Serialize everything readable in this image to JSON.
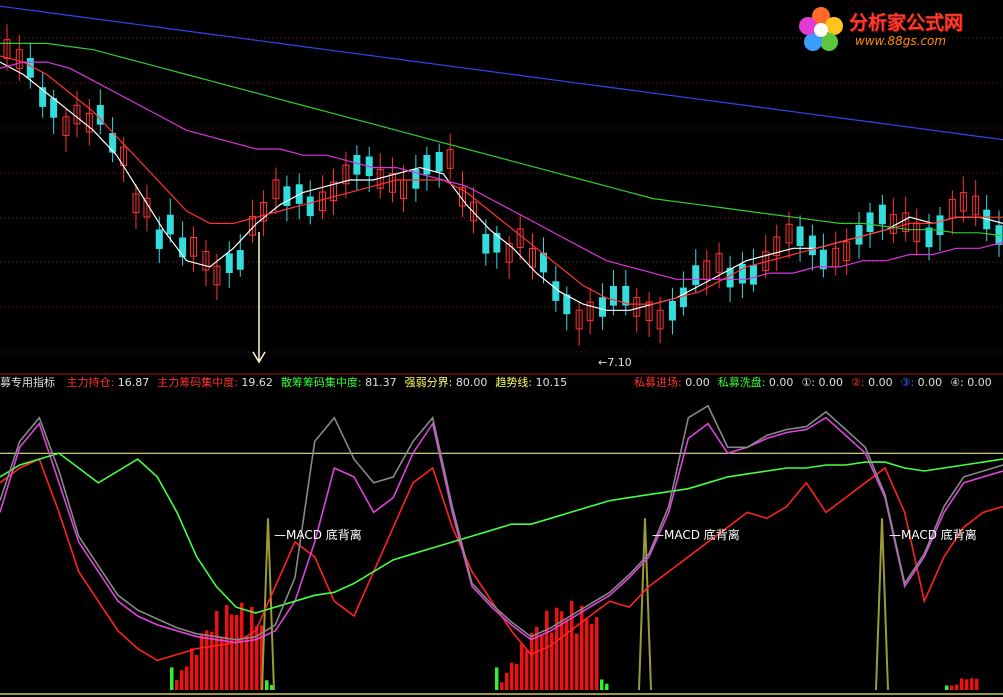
{
  "logo": {
    "title": "分析家公式网",
    "url": "www.88gs.com"
  },
  "indicator_legend": {
    "name": "募专用指标",
    "items": [
      {
        "label": "主力持仓:",
        "value": "16.87",
        "color": "#ff3333"
      },
      {
        "label": "主力筹码集中度:",
        "value": "19.62",
        "color": "#ff3333"
      },
      {
        "label": "散筹筹码集中度:",
        "value": "81.37",
        "color": "#33ff33"
      },
      {
        "label": "强弱分界:",
        "value": "80.00",
        "color": "#ffff66"
      },
      {
        "label": "趋势线:",
        "value": "10.15",
        "color": "#ffff66"
      }
    ],
    "right_items": [
      {
        "label": "私募进场:",
        "value": "0.00",
        "color": "#ff3333"
      },
      {
        "label": "私募洗盘:",
        "value": "0.00",
        "color": "#33ff33"
      },
      {
        "label": "①:",
        "value": "0.00",
        "color": "#e0e0e0"
      },
      {
        "label": "②:",
        "value": "0.00",
        "color": "#ff3333"
      },
      {
        "label": "③:",
        "value": "0.00",
        "color": "#3366ff"
      },
      {
        "label": "④:",
        "value": "0.00",
        "color": "#e0e0e0"
      }
    ]
  },
  "chart_data": [
    {
      "type": "line",
      "panel": "price",
      "low_marker": "7.10",
      "series": [
        {
          "color": "#ffffff",
          "values": [
            11.6,
            11.4,
            11.1,
            10.8,
            10.5,
            10.1,
            9.5,
            8.9,
            8.4,
            8.3,
            8.6,
            9.0,
            9.3,
            9.5,
            9.6,
            9.7,
            9.7,
            9.8,
            9.9,
            9.8,
            9.3,
            8.9,
            8.6,
            8.2,
            7.9,
            7.7,
            7.6,
            7.6,
            7.7,
            7.8,
            8.0,
            8.2,
            8.4,
            8.5,
            8.6,
            8.6,
            8.7,
            8.8,
            8.9,
            9.1,
            9.0,
            9.1,
            9.1,
            9.0
          ]
        },
        {
          "color": "#ff3333",
          "values": [
            11.7,
            11.6,
            11.4,
            11.1,
            10.8,
            10.4,
            10.0,
            9.6,
            9.2,
            9.0,
            9.0,
            9.1,
            9.2,
            9.3,
            9.4,
            9.5,
            9.6,
            9.7,
            9.7,
            9.7,
            9.5,
            9.2,
            8.9,
            8.6,
            8.3,
            8.0,
            7.8,
            7.7,
            7.7,
            7.8,
            7.9,
            8.1,
            8.3,
            8.4,
            8.5,
            8.6,
            8.7,
            8.8,
            8.9,
            9.0,
            9.0,
            9.1,
            9.1,
            9.1
          ]
        },
        {
          "color": "#dd33dd",
          "values": [
            11.5,
            11.6,
            11.6,
            11.5,
            11.3,
            11.1,
            10.9,
            10.7,
            10.5,
            10.4,
            10.3,
            10.2,
            10.2,
            10.1,
            10.1,
            10.0,
            9.9,
            9.9,
            9.8,
            9.7,
            9.6,
            9.4,
            9.2,
            9.0,
            8.8,
            8.6,
            8.4,
            8.3,
            8.2,
            8.1,
            8.1,
            8.1,
            8.1,
            8.2,
            8.2,
            8.3,
            8.3,
            8.4,
            8.4,
            8.5,
            8.5,
            8.6,
            8.6,
            8.7
          ]
        },
        {
          "color": "#33cc33",
          "values": [
            11.9,
            11.9,
            11.9,
            11.85,
            11.8,
            11.7,
            11.6,
            11.5,
            11.4,
            11.3,
            11.2,
            11.1,
            11.0,
            10.9,
            10.8,
            10.7,
            10.6,
            10.5,
            10.4,
            10.3,
            10.2,
            10.1,
            10.0,
            9.9,
            9.8,
            9.7,
            9.6,
            9.5,
            9.4,
            9.35,
            9.3,
            9.25,
            9.2,
            9.15,
            9.1,
            9.05,
            9.0,
            9.0,
            8.95,
            8.9,
            8.9,
            8.85,
            8.85,
            8.8
          ]
        },
        {
          "color": "#3344ee",
          "values": [
            12.5,
            12.45,
            12.4,
            12.35,
            12.3,
            12.25,
            12.2,
            12.15,
            12.1,
            12.05,
            12.0,
            11.95,
            11.9,
            11.85,
            11.8,
            11.75,
            11.7,
            11.65,
            11.6,
            11.55,
            11.5,
            11.45,
            11.4,
            11.35,
            11.3,
            11.25,
            11.2,
            11.15,
            11.1,
            11.05,
            11.0,
            10.95,
            10.9,
            10.85,
            10.8,
            10.75,
            10.7,
            10.65,
            10.6,
            10.55,
            10.5,
            10.45,
            10.4,
            10.35
          ]
        }
      ]
    },
    {
      "type": "line",
      "panel": "indicator",
      "annotations": [
        "MACD 底背离",
        "MACD 底背离",
        "MACD 底背离"
      ],
      "ylim": [
        0,
        100
      ],
      "reference_line": 80,
      "series": [
        {
          "color": "#ff2222",
          "values": [
            70,
            75,
            78,
            60,
            40,
            30,
            20,
            14,
            10,
            12,
            14,
            15,
            16,
            20,
            35,
            50,
            45,
            30,
            25,
            40,
            55,
            70,
            75,
            55,
            40,
            30,
            20,
            12,
            15,
            20,
            25,
            30,
            28,
            35,
            40,
            45,
            50,
            55,
            60,
            58,
            62,
            70,
            60,
            65,
            70,
            75,
            60,
            30,
            45,
            55,
            60,
            62
          ]
        },
        {
          "color": "#dd44dd",
          "values": [
            60,
            82,
            90,
            70,
            50,
            40,
            30,
            25,
            22,
            20,
            18,
            17,
            16,
            17,
            20,
            30,
            50,
            75,
            72,
            60,
            65,
            80,
            90,
            60,
            35,
            28,
            22,
            17,
            20,
            24,
            28,
            32,
            38,
            45,
            60,
            85,
            90,
            80,
            82,
            85,
            87,
            88,
            92,
            86,
            80,
            65,
            35,
            45,
            60,
            70,
            72,
            74
          ]
        },
        {
          "color": "#44ff44",
          "values": [
            72,
            76,
            78,
            80,
            75,
            70,
            74,
            78,
            72,
            60,
            45,
            35,
            28,
            26,
            28,
            30,
            32,
            33,
            36,
            40,
            44,
            46,
            48,
            50,
            52,
            54,
            56,
            56,
            58,
            60,
            62,
            64,
            65,
            66,
            67,
            68,
            70,
            72,
            73,
            74,
            75,
            75,
            76,
            76,
            77,
            77,
            75,
            74,
            75,
            76,
            77,
            78
          ]
        },
        {
          "color": "#888888",
          "values": [
            64,
            84,
            92,
            74,
            52,
            42,
            32,
            27,
            24,
            21,
            19,
            18,
            17,
            18,
            22,
            38,
            84,
            92,
            78,
            70,
            72,
            84,
            92,
            62,
            36,
            29,
            23,
            18,
            21,
            25,
            29,
            33,
            39,
            46,
            62,
            92,
            96,
            82,
            82,
            86,
            88,
            89,
            94,
            88,
            82,
            66,
            36,
            46,
            62,
            72,
            74,
            76
          ]
        }
      ]
    }
  ]
}
